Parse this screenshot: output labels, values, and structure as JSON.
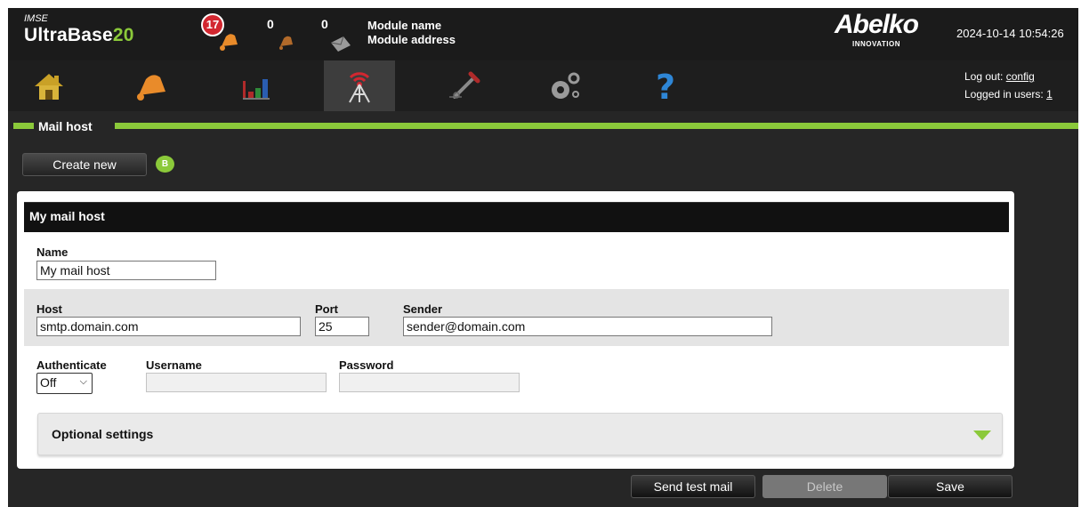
{
  "header": {
    "imse": "IMSE",
    "product_main": "UltraBase",
    "product_num": "20",
    "alarm_count": "17",
    "counter_b": "0",
    "counter_c": "0",
    "module_name": "Module name",
    "module_address": "Module address",
    "logo_text": "Abelko",
    "logo_sub": "INNOVATION",
    "datetime": "2024-10-14 10:54:26"
  },
  "nav": {
    "items": [
      "home-icon",
      "bell-icon",
      "chart-icon",
      "antenna-icon",
      "tools-icon",
      "gears-icon",
      "help-icon"
    ],
    "active": "antenna-icon",
    "logout_label": "Log out:",
    "logout_user": "config",
    "logged_in_label": "Logged in users:",
    "logged_in_count": "1"
  },
  "section": {
    "title": "Mail host"
  },
  "toolbar": {
    "create_new": "Create new",
    "help_badge": "B"
  },
  "panel": {
    "title": "My mail host",
    "name_label": "Name",
    "name_value": "My mail host",
    "host_label": "Host",
    "host_value": "smtp.domain.com",
    "port_label": "Port",
    "port_value": "25",
    "sender_label": "Sender",
    "sender_value": "sender@domain.com",
    "auth_label": "Authenticate",
    "auth_value": "Off",
    "username_label": "Username",
    "username_value": "",
    "password_label": "Password",
    "password_value": "",
    "optional_label": "Optional settings"
  },
  "actions": {
    "send_test": "Send test mail",
    "delete": "Delete",
    "save": "Save"
  },
  "colors": {
    "accent": "#8bc93a",
    "alarm": "#d22730",
    "header_bg": "#1b1b1b"
  }
}
